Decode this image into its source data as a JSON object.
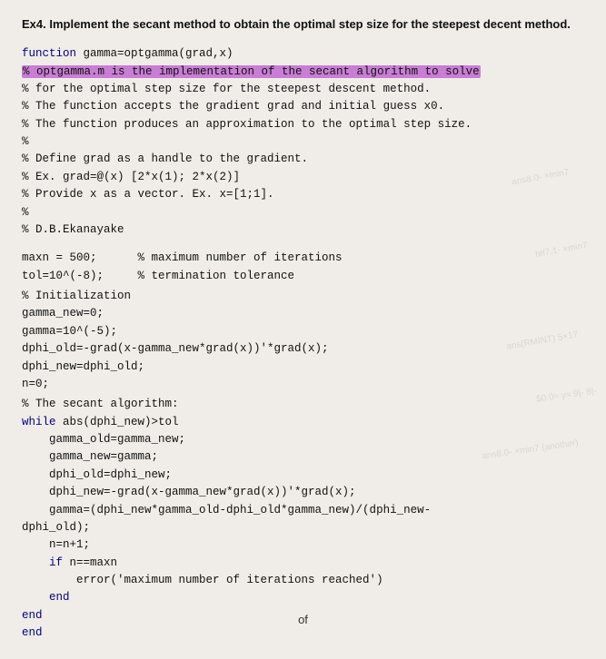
{
  "exercise": {
    "title": "Ex4. Implement the secant method to obtain the optimal step size for the steepest decent method."
  },
  "code": {
    "lines": [
      {
        "id": "fn-def",
        "text": "function gamma=optgamma(grad,x)",
        "indent": 0,
        "highlight": false
      },
      {
        "id": "comment-impl",
        "text": "% optgamma.m is the implementation of the secant algorithm to solve",
        "indent": 0,
        "highlight": true
      },
      {
        "id": "comment-step",
        "text": "% for the optimal step size for the steepest descent method.",
        "indent": 0,
        "highlight": false
      },
      {
        "id": "comment-accepts",
        "text": "% The function accepts the gradient grad and initial guess x0.",
        "indent": 0,
        "highlight": false
      },
      {
        "id": "comment-produces",
        "text": "% The function produces an approximation to the optimal step size.",
        "indent": 0,
        "highlight": false
      },
      {
        "id": "blank1",
        "text": "%",
        "indent": 0,
        "highlight": false
      },
      {
        "id": "comment-define",
        "text": "% Define grad as a handle to the gradient.",
        "indent": 0,
        "highlight": false
      },
      {
        "id": "comment-ex1",
        "text": "% Ex. grad=@(x) [2*x(1); 2*x(2)]",
        "indent": 0,
        "highlight": false
      },
      {
        "id": "comment-provide",
        "text": "% Provide x as a vector. Ex. x=[1;1].",
        "indent": 0,
        "highlight": false
      },
      {
        "id": "blank2",
        "text": "%",
        "indent": 0,
        "highlight": false
      },
      {
        "id": "author",
        "text": "% D.B.Ekanayake",
        "indent": 0,
        "highlight": false
      },
      {
        "id": "blank3",
        "text": "",
        "indent": 0,
        "highlight": false
      },
      {
        "id": "blank4",
        "text": "",
        "indent": 0,
        "highlight": false
      },
      {
        "id": "maxn",
        "text": "maxn = 500;      % maximum number of iterations",
        "indent": 0,
        "highlight": false
      },
      {
        "id": "tol",
        "text": "tol=10^(-8);     % termination tolerance",
        "indent": 0,
        "highlight": false
      },
      {
        "id": "blank5",
        "text": "",
        "indent": 0,
        "highlight": false
      },
      {
        "id": "comment-init",
        "text": "% Initialization",
        "indent": 0,
        "highlight": false
      },
      {
        "id": "gamma-new-0",
        "text": "gamma_new=0;",
        "indent": 0,
        "highlight": false
      },
      {
        "id": "gamma-init",
        "text": "gamma=10^(-5);",
        "indent": 0,
        "highlight": false
      },
      {
        "id": "dphi-old",
        "text": "dphi_old=-grad(x-gamma_new*grad(x))'*grad(x);",
        "indent": 0,
        "highlight": false
      },
      {
        "id": "dphi-new",
        "text": "dphi_new=dphi_old;",
        "indent": 0,
        "highlight": false
      },
      {
        "id": "n-0",
        "text": "n=0;",
        "indent": 0,
        "highlight": false
      },
      {
        "id": "blank6",
        "text": "",
        "indent": 0,
        "highlight": false
      },
      {
        "id": "comment-secant",
        "text": "% The secant algorithm:",
        "indent": 0,
        "highlight": false
      },
      {
        "id": "while-line",
        "text": "while abs(dphi_new)>tol",
        "indent": 0,
        "highlight": false
      },
      {
        "id": "gamma-old-set",
        "text": "    gamma_old=gamma_new;",
        "indent": 0,
        "highlight": false
      },
      {
        "id": "gamma-new-set",
        "text": "    gamma_new=gamma;",
        "indent": 0,
        "highlight": false
      },
      {
        "id": "dphi-old-set",
        "text": "    dphi_old=dphi_new;",
        "indent": 0,
        "highlight": false
      },
      {
        "id": "dphi-new-calc",
        "text": "    dphi_new=-grad(x-gamma_new*grad(x))'*grad(x);",
        "indent": 0,
        "highlight": false
      },
      {
        "id": "gamma-calc",
        "text": "    gamma=(dphi_new*gamma_old-dphi_old*gamma_new)/(dphi_new-",
        "indent": 0,
        "highlight": false
      },
      {
        "id": "dphi-old2",
        "text": "dphi_old);",
        "indent": 0,
        "highlight": false
      },
      {
        "id": "n-inc",
        "text": "    n=n+1;",
        "indent": 0,
        "highlight": false
      },
      {
        "id": "if-line",
        "text": "    if n==maxn",
        "indent": 0,
        "highlight": false
      },
      {
        "id": "error-line",
        "text": "        error('maximum number of iterations reached')",
        "indent": 0,
        "highlight": false
      },
      {
        "id": "end-if",
        "text": "    end",
        "indent": 0,
        "highlight": false
      },
      {
        "id": "end-while",
        "text": "end",
        "indent": 0,
        "highlight": false
      },
      {
        "id": "end-fn",
        "text": "end",
        "indent": 0,
        "highlight": false
      }
    ]
  },
  "pagination": {
    "label": "of",
    "current": "",
    "total": ""
  }
}
